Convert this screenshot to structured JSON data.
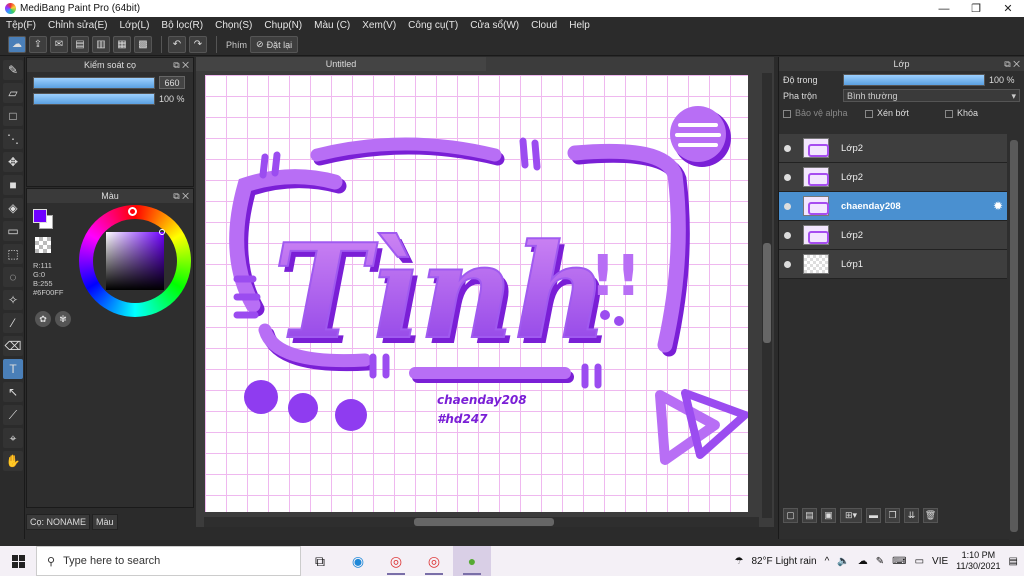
{
  "window": {
    "title": "MediBang Paint Pro (64bit)",
    "minimize": "—",
    "maximize": "❐",
    "close": "✕"
  },
  "menu": [
    "Tệp(F)",
    "Chỉnh sửa(E)",
    "Lớp(L)",
    "Bộ lọc(R)",
    "Chọn(S)",
    "Chụp(N)",
    "Màu (C)",
    "Xem(V)",
    "Công cụ(T)",
    "Cửa sổ(W)",
    "Cloud",
    "Help"
  ],
  "toolbar": {
    "stroke_label": "Phím",
    "reset_label": "Đặt lại"
  },
  "brush_panel": {
    "title": "Kiểm soát cọ",
    "size_value": "660",
    "opacity_value": "100 %",
    "size_fraction": 1.0,
    "opacity_fraction": 1.0
  },
  "color_panel": {
    "title": "Màu",
    "r": "R:111",
    "g": "G:0",
    "b": "B:255",
    "hex": "#6F00FF",
    "primary": "#6F00FF"
  },
  "bottom_tabs": {
    "brush_tab": "Cọ: NONAME",
    "color_tab": "Màu"
  },
  "document": {
    "tab_title": "Untitled"
  },
  "artwork": {
    "main_word": "Tình",
    "exclaim": "!!",
    "signature": "chaenday208",
    "tag": "#hd247"
  },
  "layer_panel": {
    "title": "Lớp",
    "opacity_label": "Độ trong",
    "opacity_value": "100 %",
    "opacity_fraction": 1.0,
    "blend_label": "Pha trộn",
    "blend_value": "Bình thường",
    "protect_alpha": "Bảo vệ alpha",
    "clipping": "Xén bớt",
    "lock": "Khóa",
    "layers": [
      {
        "name": "Lớp2",
        "selected": false
      },
      {
        "name": "Lớp2",
        "selected": false
      },
      {
        "name": "chaenday208",
        "selected": true
      },
      {
        "name": "Lớp2",
        "selected": false
      },
      {
        "name": "Lớp1",
        "selected": false
      }
    ]
  },
  "taskbar": {
    "search_placeholder": "Type here to search",
    "weather": "82°F  Light rain",
    "lang": "VIE",
    "time": "1:10 PM",
    "date": "11/30/2021"
  }
}
